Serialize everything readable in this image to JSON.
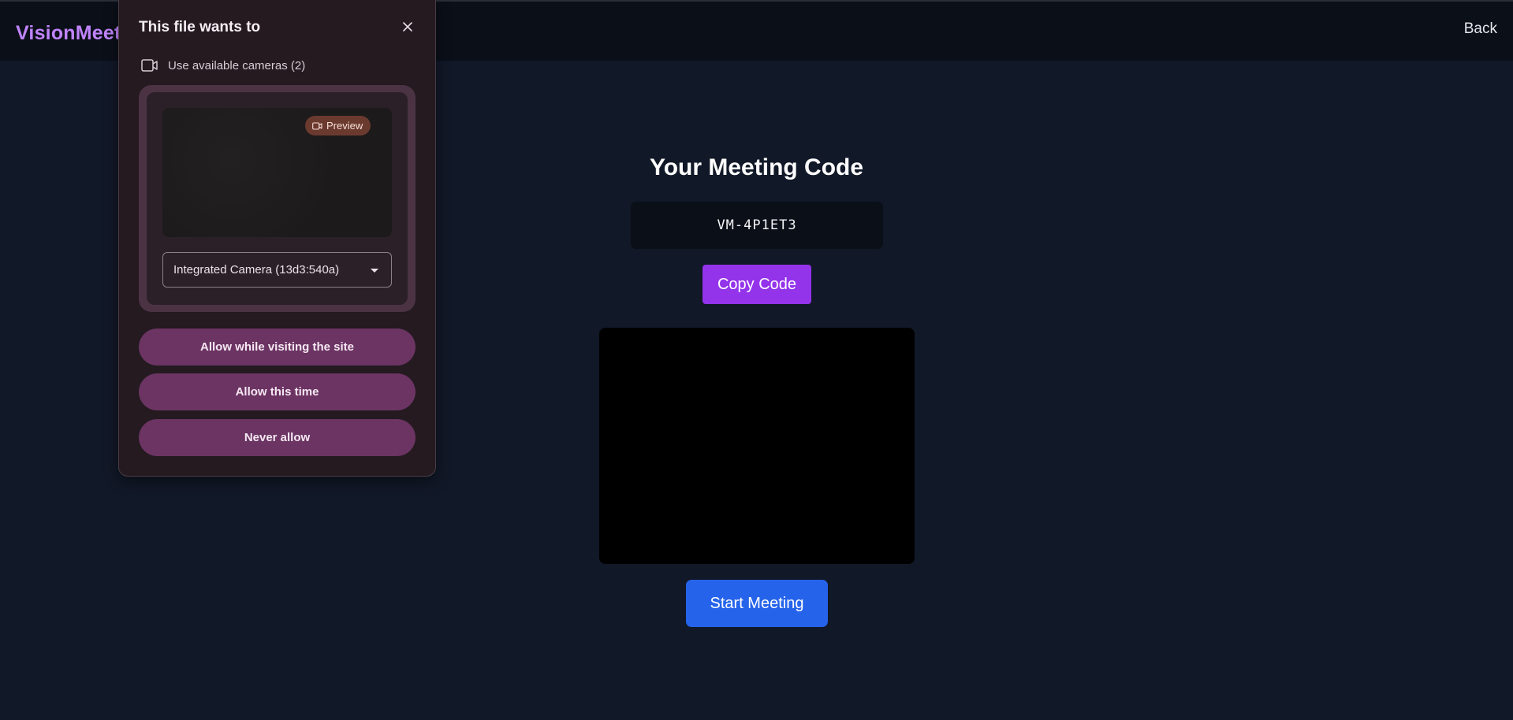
{
  "app": {
    "brand": "VisionMeet",
    "back_label": "Back"
  },
  "main": {
    "title": "Your Meeting Code",
    "meeting_code": "VM-4P1ET3",
    "copy_button": "Copy Code",
    "start_button": "Start Meeting"
  },
  "permission_popup": {
    "title": "This file wants to",
    "permission_label": "Use available cameras (2)",
    "preview_badge": "Preview",
    "camera_selected": "Integrated Camera (13d3:540a)",
    "buttons": {
      "allow_visit": "Allow while visiting the site",
      "allow_once": "Allow this time",
      "never": "Never allow"
    }
  },
  "colors": {
    "background": "#111827",
    "brand": "#c084fc",
    "copy_button": "#9333ea",
    "start_button": "#2563eb",
    "popup_background": "#241a20",
    "popup_button": "#6b3463",
    "preview_badge": "#6b3a2f"
  },
  "icons": {
    "close": "close-icon",
    "camera": "video-camera-icon",
    "dropdown": "caret-down-icon"
  }
}
